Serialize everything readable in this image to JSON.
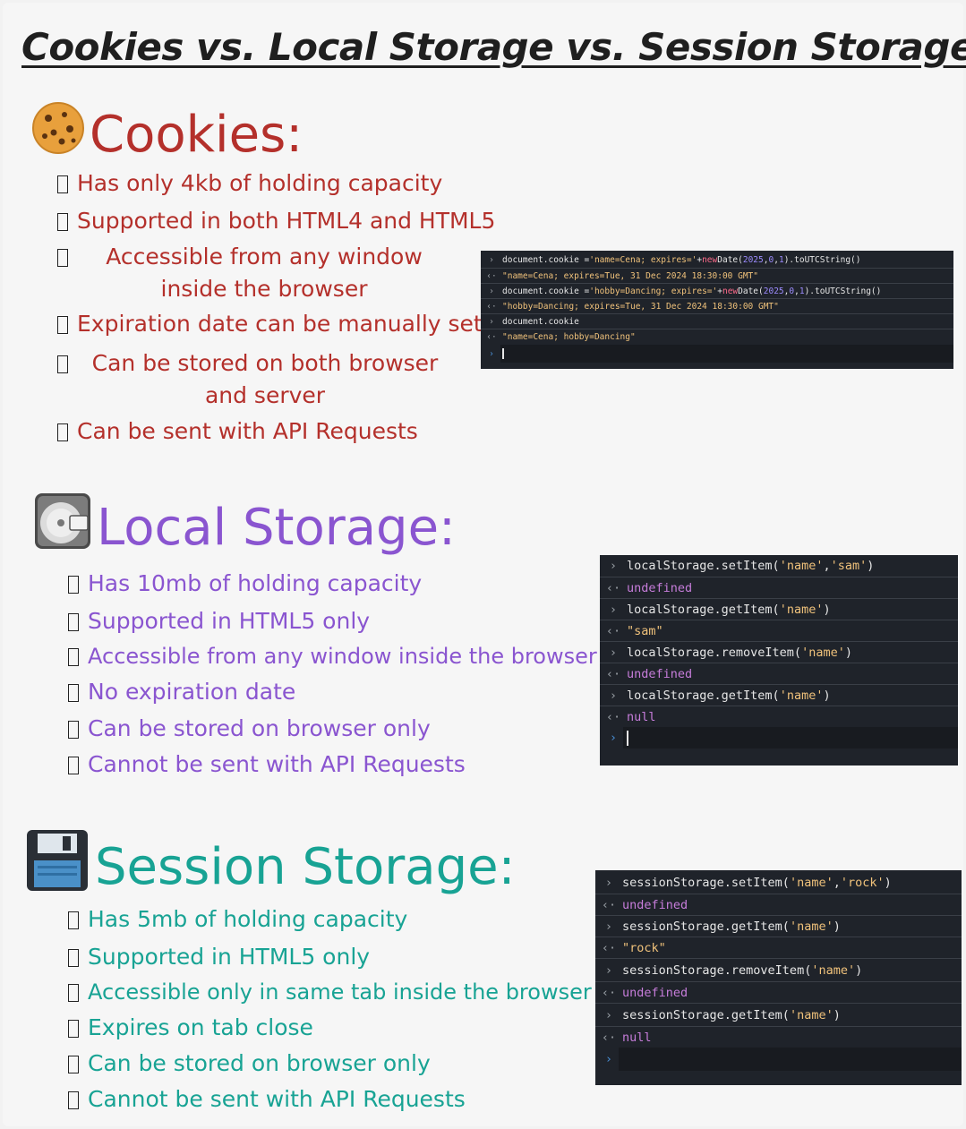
{
  "title": "Cookies vs. Local Storage vs. Session Storage",
  "cookies": {
    "heading": "Cookies:",
    "icon": "cookie-icon",
    "color": "#b4302b",
    "items": [
      "Has only 4kb of holding capacity",
      "Supported in both HTML4 and HTML5",
      "Accessible from any window inside the browser",
      "Expiration date can be manually set",
      "Can be stored on both browser and server",
      "Can be sent with API Requests"
    ],
    "console": [
      {
        "type": "input",
        "parts": [
          "document.cookie = ",
          "'name=Cena; expires='",
          " + ",
          "new",
          " Date(",
          "2025",
          ", ",
          "0",
          ", ",
          "1",
          ").toUTCString()"
        ]
      },
      {
        "type": "output",
        "text": "\"name=Cena; expires=Tue, 31 Dec 2024 18:30:00 GMT\""
      },
      {
        "type": "input",
        "parts": [
          "document.cookie = ",
          "'hobby=Dancing; expires='",
          " + ",
          "new",
          " Date(",
          "2025",
          ", ",
          "0",
          ", ",
          "1",
          ").toUTCString()"
        ]
      },
      {
        "type": "output",
        "text": "\"hobby=Dancing; expires=Tue, 31 Dec 2024 18:30:00 GMT\""
      },
      {
        "type": "input",
        "text": "document.cookie"
      },
      {
        "type": "output",
        "text": "\"name=Cena; hobby=Dancing\""
      }
    ]
  },
  "local": {
    "heading": "Local Storage:",
    "icon": "disk-drive-icon",
    "color": "#8a55d0",
    "items": [
      "Has 10mb of holding capacity",
      "Supported in HTML5 only",
      "Accessible from any window inside the browser",
      "No expiration date",
      "Can be stored on browser only",
      "Cannot be sent with API Requests"
    ],
    "console": [
      {
        "type": "input",
        "parts": [
          "localStorage.setItem(",
          "'name'",
          ", ",
          "'sam'",
          ")"
        ]
      },
      {
        "type": "result",
        "text": "undefined"
      },
      {
        "type": "input",
        "parts": [
          "localStorage.getItem(",
          "'name'",
          ")"
        ]
      },
      {
        "type": "output",
        "text": "\"sam\""
      },
      {
        "type": "input",
        "parts": [
          "localStorage.removeItem(",
          "'name'",
          ")"
        ]
      },
      {
        "type": "result",
        "text": "undefined"
      },
      {
        "type": "input",
        "parts": [
          "localStorage.getItem(",
          "'name'",
          ")"
        ]
      },
      {
        "type": "result",
        "text": "null"
      }
    ]
  },
  "session": {
    "heading": "Session Storage:",
    "icon": "floppy-disk-icon",
    "color": "#18a394",
    "items": [
      "Has 5mb of holding capacity",
      "Supported in HTML5 only",
      "Accessible only in same tab inside the browser",
      "Expires on tab close",
      "Can be stored on browser only",
      "Cannot be sent with API Requests"
    ],
    "console": [
      {
        "type": "input",
        "parts": [
          "sessionStorage.setItem(",
          "'name'",
          ", ",
          "'rock'",
          ")"
        ]
      },
      {
        "type": "result",
        "text": "undefined"
      },
      {
        "type": "input",
        "parts": [
          "sessionStorage.getItem(",
          "'name'",
          ")"
        ]
      },
      {
        "type": "output",
        "text": "\"rock\""
      },
      {
        "type": "input",
        "parts": [
          "sessionStorage.removeItem(",
          "'name'",
          ")"
        ]
      },
      {
        "type": "result",
        "text": "undefined"
      },
      {
        "type": "input",
        "parts": [
          "sessionStorage.getItem(",
          "'name'",
          ")"
        ]
      },
      {
        "type": "result",
        "text": "null"
      }
    ]
  }
}
